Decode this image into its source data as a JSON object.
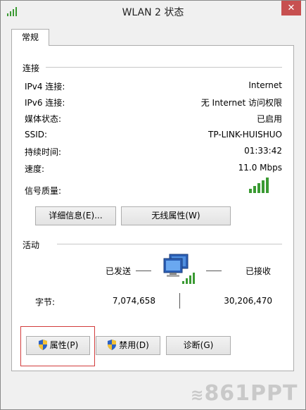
{
  "window": {
    "title": "WLAN 2 状态",
    "close_label": "✕"
  },
  "tabs": [
    {
      "label": "常规"
    }
  ],
  "connection": {
    "group_label": "连接",
    "rows": [
      {
        "label": "IPv4 连接:",
        "value": "Internet"
      },
      {
        "label": "IPv6 连接:",
        "value": "无 Internet 访问权限"
      },
      {
        "label": "媒体状态:",
        "value": "已启用"
      },
      {
        "label": "SSID:",
        "value": "TP-LINK-HUISHUO"
      },
      {
        "label": "持续时间:",
        "value": "01:33:42"
      },
      {
        "label": "速度:",
        "value": "11.0 Mbps"
      }
    ],
    "signal_label": "信号质量:",
    "signal_bars": 5,
    "signal_color": "#3a9a32"
  },
  "buttons_mid": {
    "details": "详细信息(E)...",
    "wireless_props": "无线属性(W)"
  },
  "activity": {
    "group_label": "活动",
    "sent_label": "已发送",
    "received_label": "已接收",
    "bytes_label": "字节:",
    "bytes_sent": "7,074,658",
    "bytes_received": "30,206,470"
  },
  "buttons_bottom": {
    "properties": "属性(P)",
    "disable": "禁用(D)",
    "diagnose": "诊断(G)"
  },
  "watermark": {
    "text": "861PPT"
  },
  "colors": {
    "highlight_border": "#d23c3c",
    "close_button": "#c75050"
  }
}
